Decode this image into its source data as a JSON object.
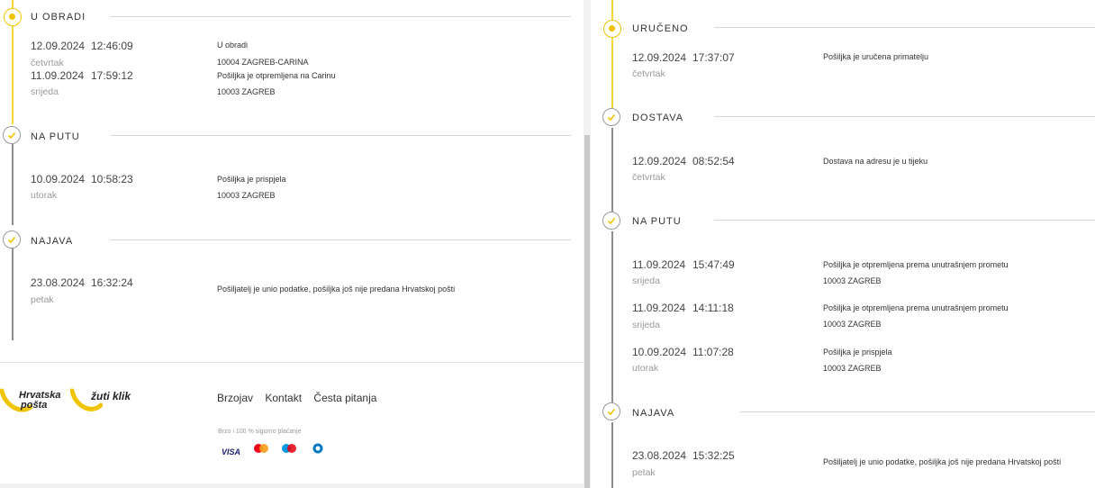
{
  "colors": {
    "accent": "#f0c400",
    "line_done": "#8d8d8d"
  },
  "left": {
    "sections": [
      {
        "title": "U OBRADI",
        "status": "active",
        "events": [
          {
            "date": "12.09.2024",
            "time": "12:46:09",
            "day": "četvrtak",
            "desc": "U obradi",
            "location": "10004 ZAGREB-CARINA"
          },
          {
            "date": "11.09.2024",
            "time": "17:59:12",
            "day": "srijeda",
            "desc": "Pošiljka je otpremljena na Carinu",
            "location": "10003 ZAGREB"
          }
        ]
      },
      {
        "title": "NA PUTU",
        "status": "done",
        "events": [
          {
            "date": "10.09.2024",
            "time": "10:58:23",
            "day": "utorak",
            "desc": "Pošiljka je prispjela",
            "location": "10003 ZAGREB"
          }
        ]
      },
      {
        "title": "NAJAVA",
        "status": "done",
        "events": [
          {
            "date": "23.08.2024",
            "time": "16:32:24",
            "day": "petak",
            "desc": "Pošiljatelj je unio podatke, pošiljka još nije predana Hrvatskoj pošti",
            "location": ""
          }
        ]
      }
    ]
  },
  "footer": {
    "logo1": [
      "Hrvatska",
      "pošta"
    ],
    "logo2": "žuti klik",
    "links": [
      "Brzojav",
      "Kontakt",
      "Česta pitanja"
    ],
    "payment_caption": "Brzo i 100 % sigurno plaćanje",
    "payment_icons": [
      "visa-icon",
      "mastercard-icon",
      "maestro-icon",
      "diners-icon"
    ],
    "visa_label": "VISA"
  },
  "right": {
    "sections": [
      {
        "title": "URUČENO",
        "status": "active",
        "events": [
          {
            "date": "12.09.2024",
            "time": "17:37:07",
            "day": "četvrtak",
            "desc": "Pošiljka je uručena primatelju",
            "location": ""
          }
        ]
      },
      {
        "title": "DOSTAVA",
        "status": "done",
        "events": [
          {
            "date": "12.09.2024",
            "time": "08:52:54",
            "day": "četvrtak",
            "desc": "Dostava na adresu je u tijeku",
            "location": ""
          }
        ]
      },
      {
        "title": "NA PUTU",
        "status": "done",
        "events": [
          {
            "date": "11.09.2024",
            "time": "15:47:49",
            "day": "srijeda",
            "desc": "Pošiljka je otpremljena prema unutrašnjem prometu",
            "location": "10003 ZAGREB"
          },
          {
            "date": "11.09.2024",
            "time": "14:11:18",
            "day": "srijeda",
            "desc": "Pošiljka je otpremljena prema unutrašnjem prometu",
            "location": "10003 ZAGREB"
          },
          {
            "date": "10.09.2024",
            "time": "11:07:28",
            "day": "utorak",
            "desc": "Pošiljka je prispjela",
            "location": "10003 ZAGREB"
          }
        ]
      },
      {
        "title": "NAJAVA",
        "status": "done",
        "events": [
          {
            "date": "23.08.2024",
            "time": "15:32:25",
            "day": "petak",
            "desc": "Pošiljatelj je unio podatke, pošiljka još nije predana Hrvatskoj pošti",
            "location": ""
          }
        ]
      }
    ]
  }
}
